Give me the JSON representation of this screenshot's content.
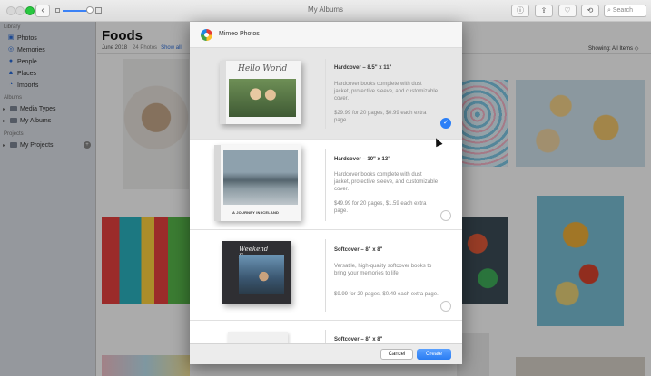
{
  "window": {
    "title": "My Albums"
  },
  "toolbar": {
    "back_label": "‹",
    "buttons": [
      {
        "icon": "info-icon",
        "glyph": "ⓘ"
      },
      {
        "icon": "share-icon",
        "glyph": "⇪"
      },
      {
        "icon": "heart-icon",
        "glyph": "♡"
      },
      {
        "icon": "rotate-icon",
        "glyph": "⟲"
      }
    ],
    "search_placeholder": "Search"
  },
  "sidebar": {
    "library_header": "Library",
    "library_items": [
      {
        "label": "Photos",
        "icon": "photos-icon",
        "glyph": "▣"
      },
      {
        "label": "Memories",
        "icon": "memories-icon",
        "glyph": "◎"
      },
      {
        "label": "People",
        "icon": "people-icon",
        "glyph": "●"
      },
      {
        "label": "Places",
        "icon": "places-icon",
        "glyph": "▲"
      },
      {
        "label": "Imports",
        "icon": "imports-icon",
        "glyph": "◔"
      }
    ],
    "albums_header": "Albums",
    "album_items": [
      {
        "label": "Media Types"
      },
      {
        "label": "My Albums"
      }
    ],
    "projects_header": "Projects",
    "project_items": [
      {
        "label": "My Projects",
        "badge": "+"
      }
    ]
  },
  "content": {
    "title": "Foods",
    "date": "June 2018",
    "count": "24 Photos",
    "show_link": "Show all",
    "showing": "Showing: All Items ◇"
  },
  "sheet": {
    "app_name": "Mimeo Photos",
    "options": [
      {
        "name": "Hardcover – 8.5\" x 11\"",
        "description": "Hardcover books complete with dust jacket, protective sleeve, and customizable cover.",
        "price": "$29.99 for 20 pages, $0.99 each extra page.",
        "selected": true,
        "cover_text": "Hello World"
      },
      {
        "name": "Hardcover – 10\" x 13\"",
        "description": "Hardcover books complete with dust jacket, protective sleeve, and customizable cover.",
        "price": "$49.99 for 20 pages, $1.59 each extra page.",
        "selected": false,
        "cover_text": "A JOURNEY IN ICELAND"
      },
      {
        "name": "Softcover – 8\" x 8\"",
        "description": "Versatile, high-quality softcover books to bring your memories to life.",
        "price": "$9.99 for 20 pages, $0.49 each extra page.",
        "selected": false,
        "cover_text": "Weekend Escape"
      },
      {
        "name": "Softcover – 8\" x 8\"",
        "description": "",
        "price": "",
        "selected": false,
        "cover_text": ""
      }
    ],
    "cancel_label": "Cancel",
    "create_label": "Create"
  },
  "colors": {
    "accent": "#2b7ff7",
    "sidebar": "#dfe3ea",
    "selected_row": "#e6e6e6"
  }
}
